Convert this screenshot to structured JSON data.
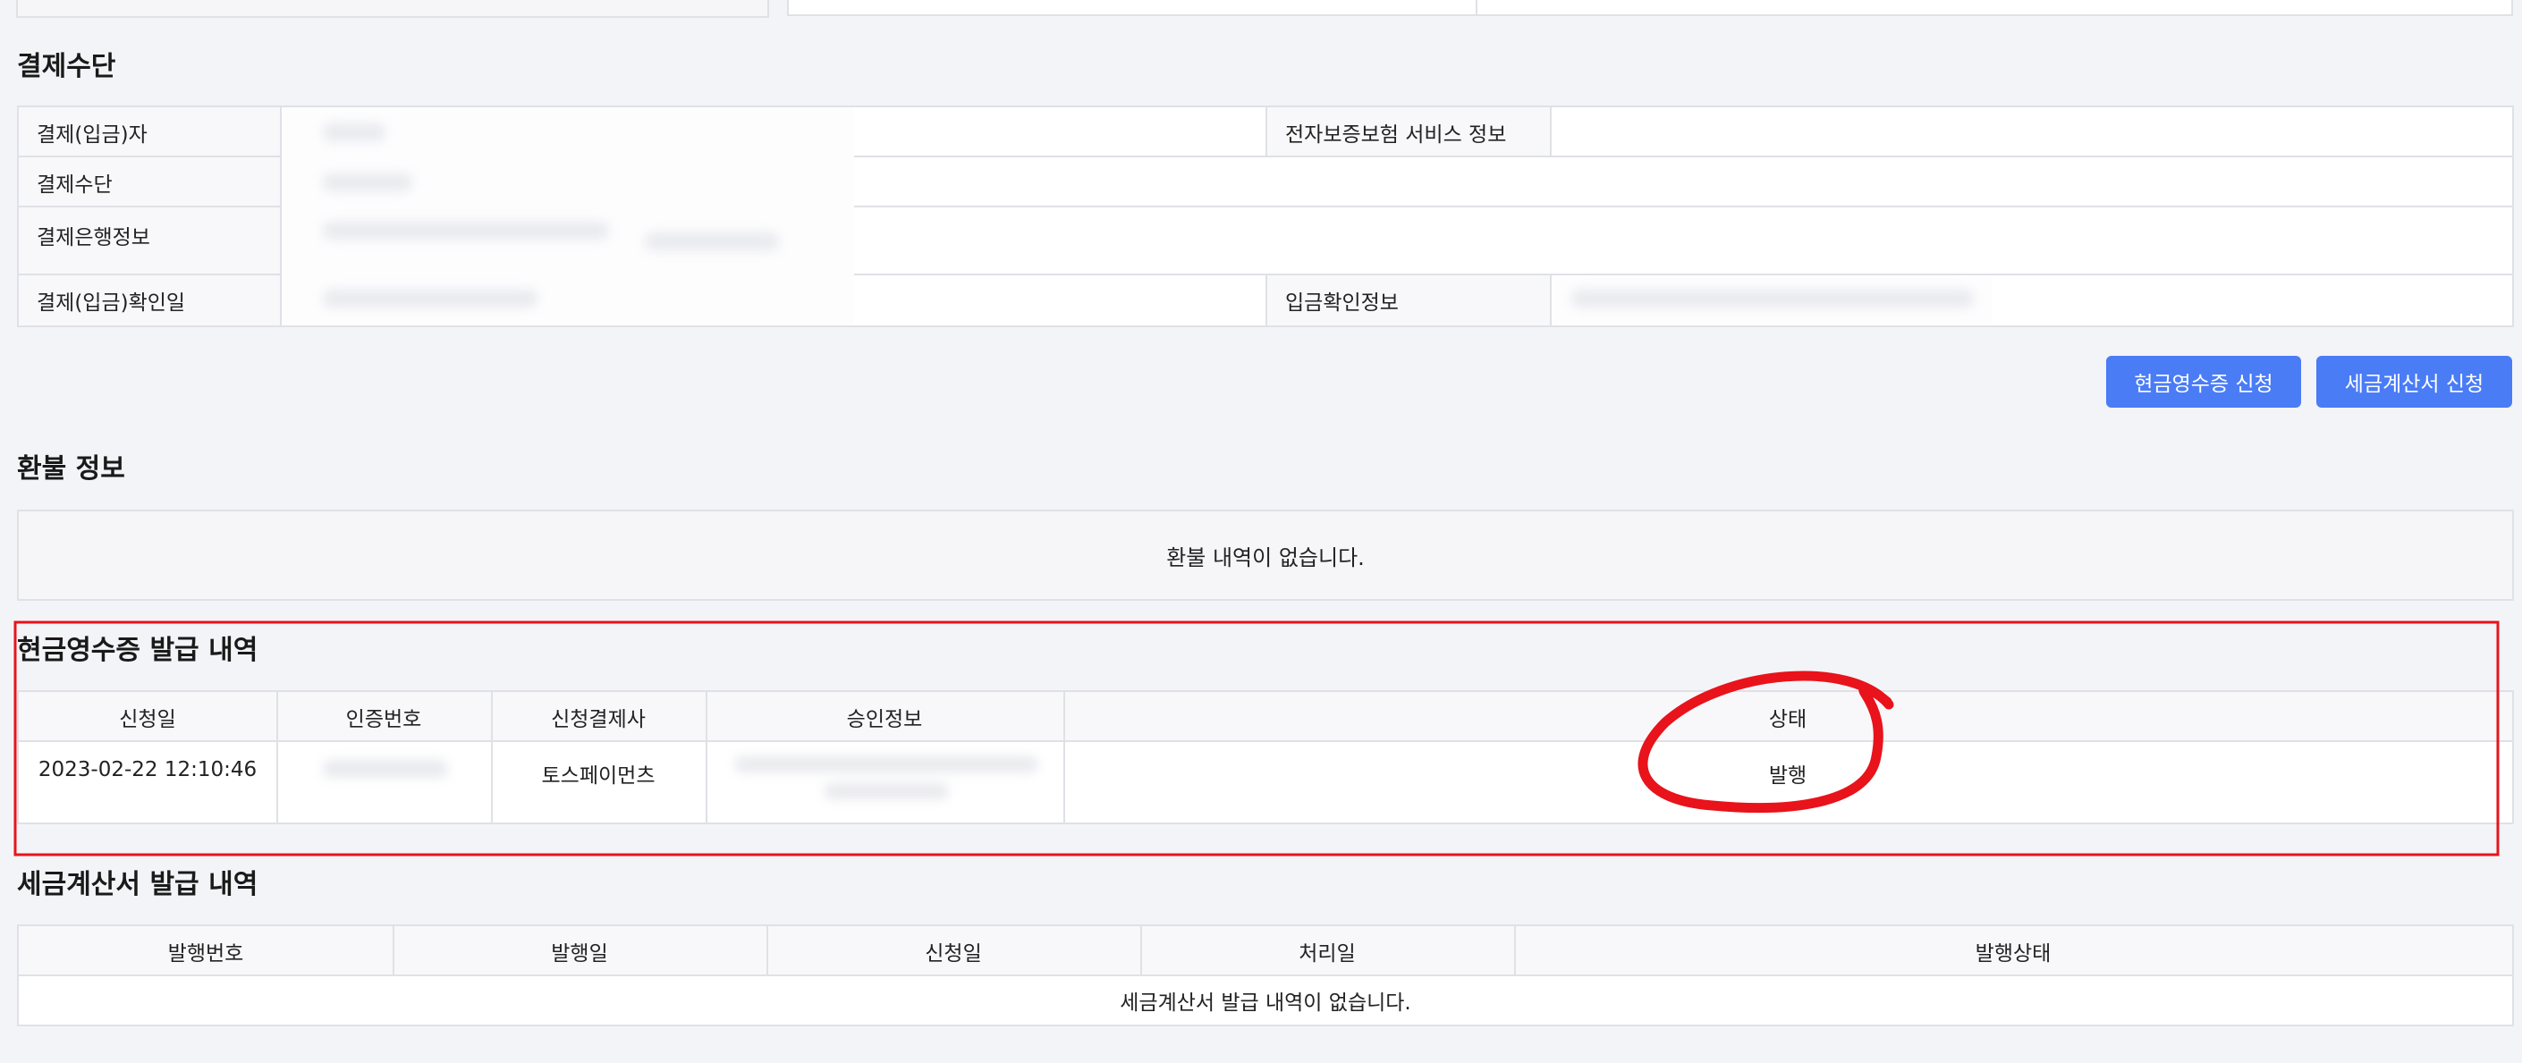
{
  "payment": {
    "title": "결제수단",
    "payer_label": "결제(입금)자",
    "guarantee_label": "전자보증보험 서비스 정보",
    "method_label": "결제수단",
    "bank_label": "결제은행정보",
    "confirm_date_label": "결제(입금)확인일",
    "deposit_info_label": "입금확인정보"
  },
  "actions": {
    "cash_receipt_button": "현금영수증 신청",
    "tax_invoice_button": "세금계산서 신청"
  },
  "refund": {
    "title": "환불 정보",
    "empty_message": "환불 내역이 없습니다."
  },
  "cash_receipt": {
    "title": "현금영수증 발급 내역",
    "columns": [
      "신청일",
      "인증번호",
      "신청결제사",
      "승인정보",
      "상태"
    ],
    "rows": [
      {
        "date": "2023-02-22 12:10:46",
        "company": "토스페이먼츠",
        "status": "발행"
      }
    ]
  },
  "tax_invoice": {
    "title": "세금계산서 발급 내역",
    "columns": [
      "발행번호",
      "발행일",
      "신청일",
      "처리일",
      "발행상태"
    ],
    "empty_message": "세금계산서 발급 내역이 없습니다."
  },
  "colors": {
    "accent": "#4a7cf6",
    "annotation": "#e8131b",
    "page_bg": "#f3f4f8",
    "border": "#dfe1e6"
  }
}
